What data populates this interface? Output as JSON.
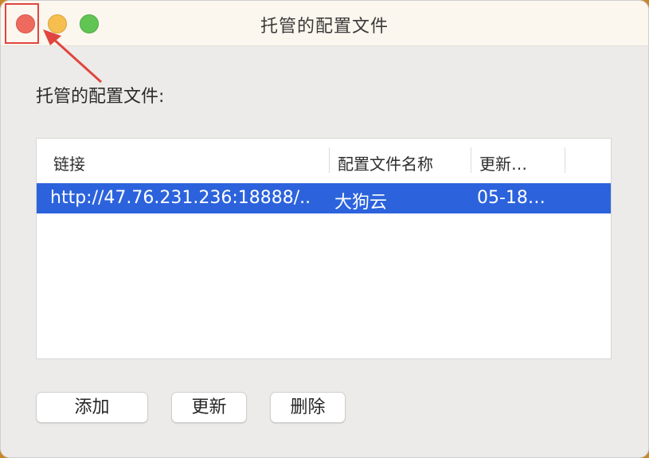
{
  "window": {
    "title": "托管的配置文件"
  },
  "section": {
    "label": "托管的配置文件:"
  },
  "table": {
    "columns": [
      "链接",
      "配置文件名称",
      "更新…"
    ],
    "rows": [
      {
        "link": "http://47.76.231.236:18888/..",
        "name": "大狗云",
        "updated": "05-18…"
      }
    ]
  },
  "buttons": {
    "add": "添加",
    "update": "更新",
    "delete": "删除"
  },
  "colors": {
    "selection": "#2c63dc",
    "close": "#ee6a5e",
    "minimize": "#f5be4f",
    "maximize": "#61c554",
    "annotation": "#e0453f"
  },
  "icons": [
    "close-icon",
    "minimize-icon",
    "maximize-icon",
    "annotation-arrow-icon"
  ]
}
